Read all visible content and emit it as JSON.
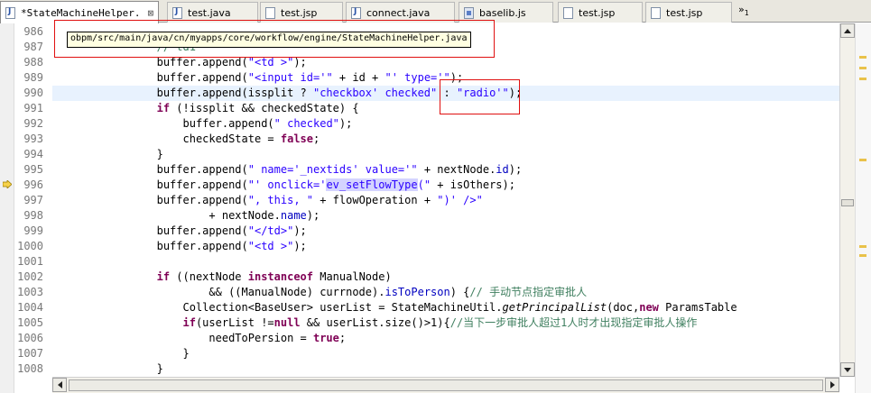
{
  "tabs": [
    {
      "label": "*StateMachineHelper.",
      "icon": "java-file-icon",
      "active": true,
      "close": "⊠"
    },
    {
      "label": "test.java",
      "icon": "java-file-icon"
    },
    {
      "label": "test.jsp",
      "icon": "jsp-file-icon"
    },
    {
      "label": "connect.java",
      "icon": "java-file-icon"
    },
    {
      "label": "baselib.js",
      "icon": "js-file-icon"
    },
    {
      "label": "test.jsp",
      "icon": "jsp-file-icon"
    },
    {
      "label": "test.jsp",
      "icon": "jsp-file-icon"
    }
  ],
  "more_tabs": {
    "symbol": "»",
    "count": "1"
  },
  "tooltip": "obpm/src/main/java/cn/myapps/core/workflow/engine/StateMachineHelper.java",
  "current_line": 990,
  "code": [
    {
      "n": "986",
      "html": ""
    },
    {
      "n": "987",
      "html": "                // td1"
    },
    {
      "n": "988",
      "html": "                buffer.append(\"<td >\");"
    },
    {
      "n": "989",
      "html": "                buffer.append(\"<input id='\" + id + \"' type='\");"
    },
    {
      "n": "990",
      "html": "                buffer.append(issplit ? \"checkbox' checked\" : \"radio'\");"
    },
    {
      "n": "991",
      "html": "                if (!issplit && checkedState) {"
    },
    {
      "n": "992",
      "html": "                    buffer.append(\" checked\");"
    },
    {
      "n": "993",
      "html": "                    checkedState = false;"
    },
    {
      "n": "994",
      "html": "                }"
    },
    {
      "n": "995",
      "html": "                buffer.append(\" name='_nextids' value='\" + nextNode.id);"
    },
    {
      "n": "996",
      "html": "                buffer.append(\"' onclick='ev_setFlowType(\" + isOthers);"
    },
    {
      "n": "997",
      "html": "                buffer.append(\", this, \" + flowOperation + \")' />\""
    },
    {
      "n": "998",
      "html": "                        + nextNode.name);"
    },
    {
      "n": "999",
      "html": "                buffer.append(\"</td>\");"
    },
    {
      "n": "1000",
      "html": "                buffer.append(\"<td >\");"
    },
    {
      "n": "1001",
      "html": ""
    },
    {
      "n": "1002",
      "html": "                if ((nextNode instanceof ManualNode)"
    },
    {
      "n": "1003",
      "html": "                        && ((ManualNode) currnode).isToPerson) {// 手动节点指定审批人"
    },
    {
      "n": "1004",
      "html": "                    Collection<BaseUser> userList = StateMachineUtil.getPrincipalList(doc,new ParamsTable"
    },
    {
      "n": "1005",
      "html": "                    if(userList !=null && userList.size()>1){//当下一步审批人超过1人时才出现指定审批人操作"
    },
    {
      "n": "1006",
      "html": "                        needToPersion = true;"
    },
    {
      "n": "1007",
      "html": "                    }"
    },
    {
      "n": "1008",
      "html": "                }"
    }
  ],
  "colors": {
    "keyword": "#7f0055",
    "string": "#2a00ff",
    "comment": "#3f7f5f",
    "field": "#0000c0",
    "annotation_box": "#e01010",
    "current_line": "#e8f2fe"
  }
}
